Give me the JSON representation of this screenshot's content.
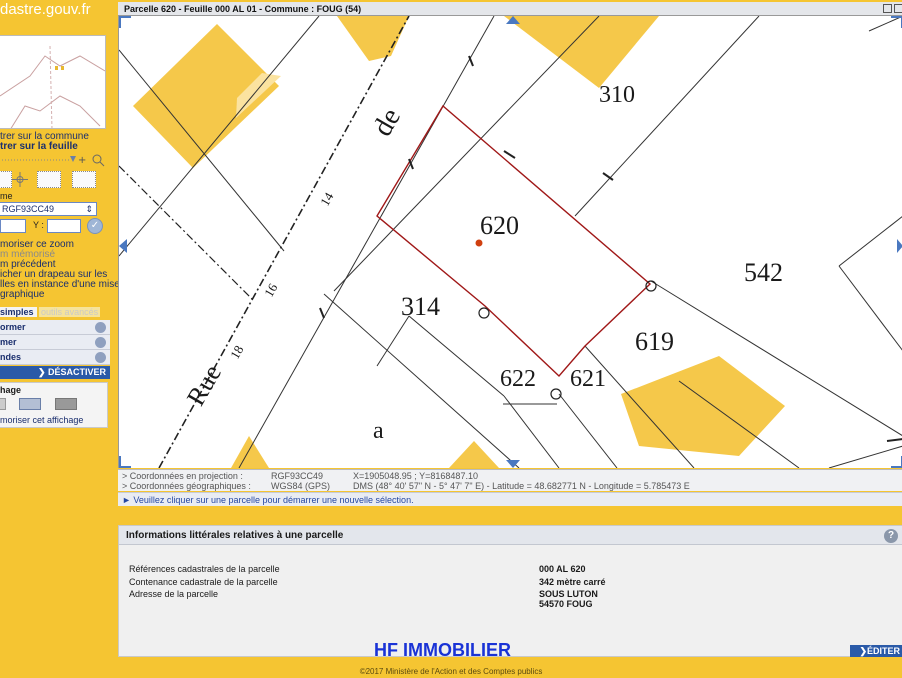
{
  "logo": {
    "text": "dastre.gouv.fr"
  },
  "window": {
    "title": "Parcelle 620 - Feuille 000 AL 01 - Commune : FOUG (54)"
  },
  "sidebar": {
    "center_commune": "trer sur la commune",
    "center_feuille": "trer sur la feuille",
    "system_label": "me",
    "projection_value": "RGF93CC49",
    "y_label": "Y :",
    "memo_zoom": "moriser ce zoom",
    "zoom_memorise": "m mémorisé",
    "zoom_precedent": "m précédent",
    "flag_line1": "icher un drapeau sur les",
    "flag_line2": "lles en instance d'une mise",
    "flag_line3": "graphique",
    "tab_simple": "simples",
    "tab_advanced": "outils avancés",
    "acc_items": [
      "ormer",
      "mer",
      "ndes"
    ],
    "deactivate": "DÉSACTIVER",
    "display_title": "hage",
    "memo_display": "moriser cet affichage"
  },
  "map": {
    "parcels": [
      "310",
      "620",
      "542",
      "314",
      "619",
      "622",
      "621",
      "a"
    ],
    "street_words": [
      "Rue",
      "de"
    ],
    "numbers": [
      "18",
      "16",
      "14"
    ]
  },
  "coords": {
    "proj_label": "> Coordonnées en projection :",
    "geo_label": "> Coordonnées géographiques :",
    "proj_system": "RGF93CC49",
    "geo_system": "WGS84 (GPS)",
    "proj_value": "X=1905048.95 ; Y=8168487.10",
    "geo_value": "DMS (48° 40' 57\" N - 5° 47' 7\" E) - Latitude = 48.682771 N - Longitude = 5.785473 E"
  },
  "hint": "► Veuillez cliquer sur une parcelle pour démarrer une nouvelle sélection.",
  "info": {
    "title": "Informations littérales relatives à une parcelle",
    "help": "?",
    "rows": [
      {
        "label": "Références cadastrales de la parcelle",
        "value": "000 AL 620"
      },
      {
        "label": "Contenance cadastrale de la parcelle",
        "value": "342 mètre carré"
      },
      {
        "label": "Adresse de la parcelle",
        "value": "SOUS LUTON",
        "value2": "54570 FOUG"
      }
    ],
    "edit": "ÉDITER"
  },
  "watermark": "HF IMMOBILIER",
  "footer": "©2017 Ministère de l'Action et des Comptes publics"
}
